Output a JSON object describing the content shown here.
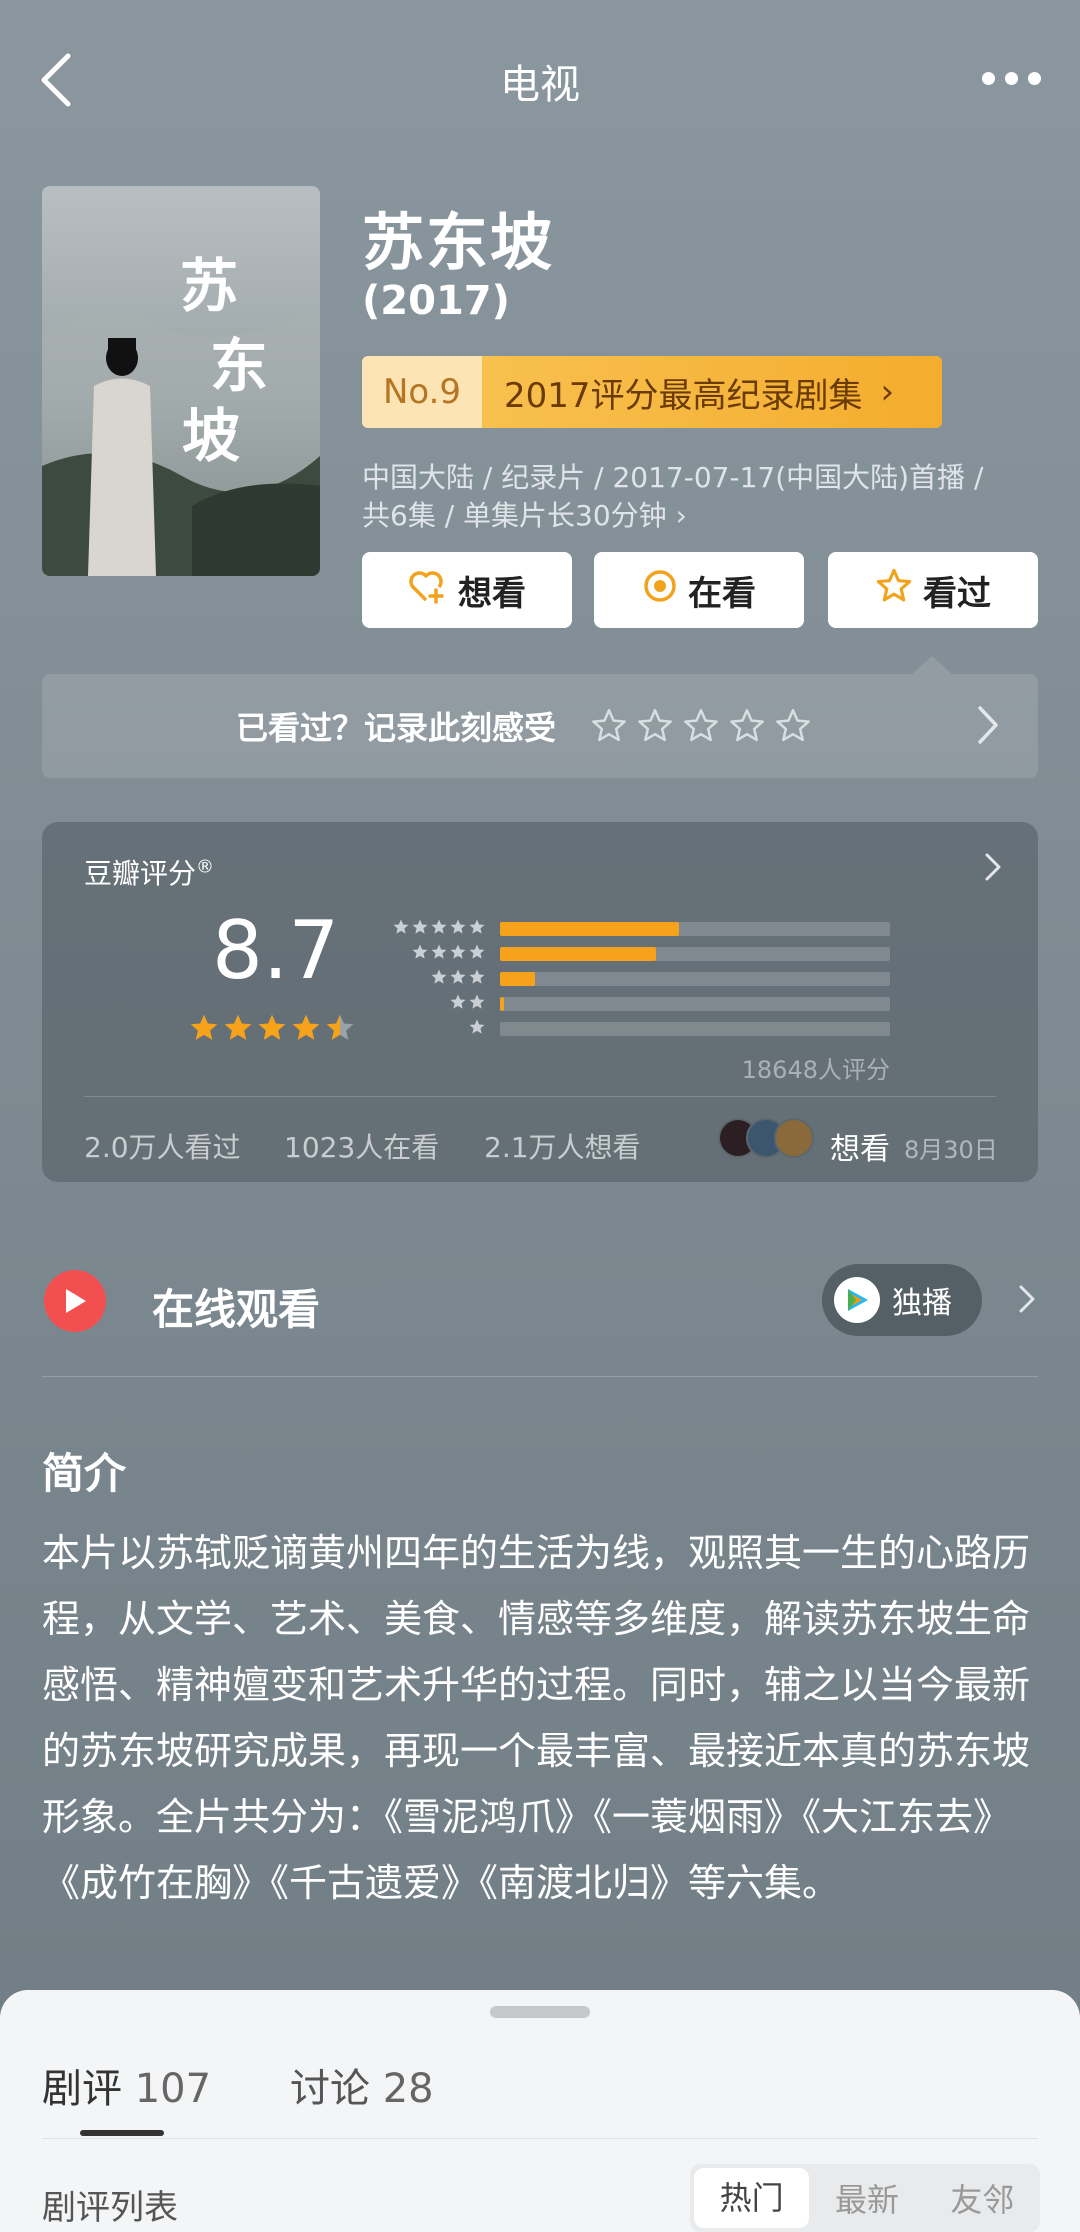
{
  "header": {
    "title": "电视"
  },
  "show": {
    "title": "苏东坡",
    "year": "(2017)",
    "poster_title": "苏东坡",
    "rank": {
      "no": "No.9",
      "label": "2017评分最高纪录剧集",
      "arrow": "›"
    },
    "meta_line1": "中国大陆 / 纪录片 / 2017-07-17(中国大陆)首播 /",
    "meta_line2": "共6集 / 单集片长30分钟 ›"
  },
  "actions": {
    "want": "想看",
    "watching": "在看",
    "watched": "看过"
  },
  "record": {
    "text": "已看过？记录此刻感受"
  },
  "rating": {
    "label": "豆瓣评分",
    "mark": "®",
    "score": "8.7",
    "score_stars": 4.5,
    "count": "18648人评分",
    "distribution": [
      0.46,
      0.4,
      0.09,
      0.01,
      0.0
    ],
    "stats": {
      "watched": "2.0万人看过",
      "watching": "1023人在看",
      "wants": "2.1万人想看"
    },
    "friend_action": "想看",
    "friend_date": "8月30日"
  },
  "online": {
    "title": "在线观看",
    "exclusive": "独播"
  },
  "intro": {
    "heading": "简介",
    "text": "本片以苏轼贬谪黄州四年的生活为线，观照其一生的心路历程，从文学、艺术、美食、情感等多维度，解读苏东坡生命感悟、精神嬗变和艺术升华的过程。同时，辅之以当今最新的苏东坡研究成果，再现一个最丰富、最接近本真的苏东坡形象。全片共分为：《雪泥鸿爪》《一蓑烟雨》《大江东去》《成竹在胸》《千古遗爱》《南渡北归》等六集。"
  },
  "sheet": {
    "tab_reviews": "剧评",
    "tab_reviews_count": "107",
    "tab_discuss": "讨论",
    "tab_discuss_count": "28",
    "list_label": "剧评列表",
    "sort_options": [
      "热门",
      "最新",
      "友邻"
    ]
  },
  "colors": {
    "accent": "#f7a21b",
    "play": "#f25050",
    "badge": "#f4ad2d"
  }
}
